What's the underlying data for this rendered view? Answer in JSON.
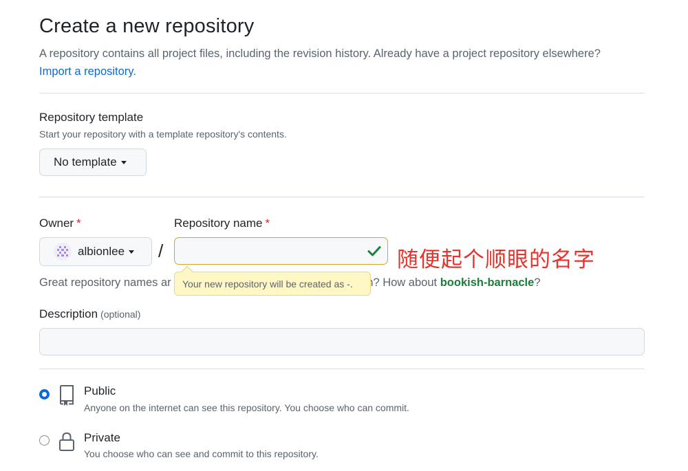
{
  "header": {
    "title": "Create a new repository",
    "subtitle": "A repository contains all project files, including the revision history. Already have a project repository elsewhere?",
    "import_link": "Import a repository."
  },
  "template": {
    "title": "Repository template",
    "description": "Start your repository with a template repository's contents.",
    "button_label": "No template"
  },
  "owner": {
    "label": "Owner",
    "required_mark": "*",
    "value": "albionlee",
    "avatar_icon": "identicon-avatar"
  },
  "repo_name": {
    "label": "Repository name",
    "required_mark": "*",
    "value": "",
    "status_icon": "check-icon",
    "separator": "/"
  },
  "annotation": {
    "text": "随便起个顺眼的名字",
    "color": "#e8322b"
  },
  "hint": {
    "before": "Great repository names ar",
    "after": "ation? How about",
    "suggestion": "bookish-barnacle",
    "end": "?"
  },
  "tooltip": {
    "text": "Your new repository will be created as -."
  },
  "description": {
    "label": "Description",
    "optional": "(optional)",
    "value": ""
  },
  "visibility": {
    "public": {
      "title": "Public",
      "description": "Anyone on the internet can see this repository. You choose who can commit.",
      "selected": true,
      "icon": "repo-icon"
    },
    "private": {
      "title": "Private",
      "description": "You choose who can see and commit to this repository.",
      "selected": false,
      "icon": "lock-icon"
    }
  },
  "colors": {
    "link": "#0969da",
    "success": "#1a7f37",
    "required": "#d1242f",
    "input_warning_border": "#d4a72c",
    "tooltip_bg": "#fff8c5"
  }
}
